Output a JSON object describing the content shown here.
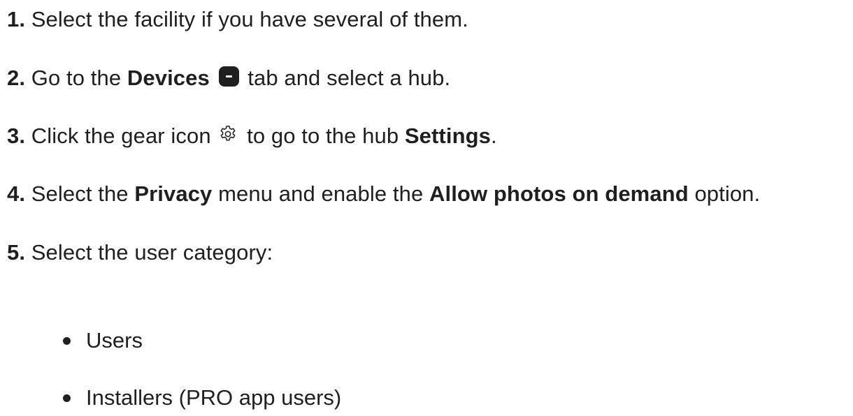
{
  "steps": [
    {
      "number": "1.",
      "text": " Select the facility if you have several of them."
    },
    {
      "number": "2.",
      "pre": " Go to the ",
      "bold": "Devices",
      "icon": "devices-tab-icon",
      "post": " tab and select a hub."
    },
    {
      "number": "3.",
      "pre": " Click the gear icon ",
      "icon": "gear-icon",
      "mid": " to go to the hub ",
      "bold": "Settings",
      "post": "."
    },
    {
      "number": "4.",
      "pre": " Select the ",
      "bold1": "Privacy",
      "mid": " menu and enable the ",
      "bold2": "Allow photos on demand",
      "post": " option."
    },
    {
      "number": "5.",
      "text": " Select the user category:"
    }
  ],
  "user_categories": [
    "Users",
    "Installers (PRO app users)"
  ],
  "colors": {
    "text": "#1f1f1f",
    "background": "#ffffff"
  }
}
